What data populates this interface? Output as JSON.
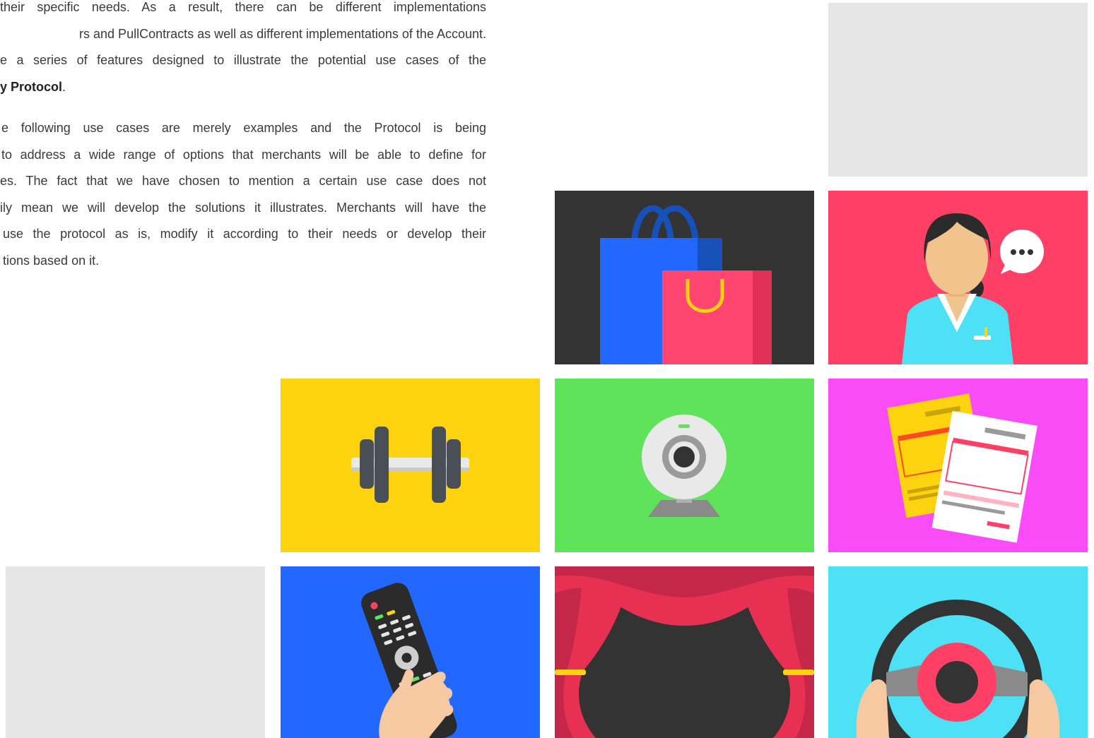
{
  "intro": {
    "paragraph1": [
      "their specific needs. As a result, there can be different implementations",
      "rs and PullContracts as well as different implementations of the Account.",
      "e a series of features designed to illustrate the potential use cases of the"
    ],
    "paragraph1_last_bold": "y Protocol",
    "paragraph1_last_tail": ".",
    "paragraph2": [
      "e following use cases are merely examples and the Protocol is being",
      "to address a wide range of options that merchants will be able to define for",
      "es. The fact that we have chosen to mention a certain use case does not",
      "ily mean we will develop the solutions it illustrates. Merchants will have the",
      "use the protocol as is, modify it according to their needs or develop their",
      "tions based on it."
    ]
  },
  "tiles": [
    {
      "name": "tile-placeholder-top",
      "illustration": "blank",
      "color": "#e6e6e6"
    },
    {
      "name": "tile-shopping",
      "illustration": "shopping-bags-icon",
      "color": "#333333"
    },
    {
      "name": "tile-assistant",
      "illustration": "customer-service-icon",
      "color": "#ff4066"
    },
    {
      "name": "tile-fitness",
      "illustration": "dumbbell-icon",
      "color": "#fdd20e"
    },
    {
      "name": "tile-webcam",
      "illustration": "webcam-icon",
      "color": "#5fe35a"
    },
    {
      "name": "tile-bills",
      "illustration": "utility-bills-icon",
      "color": "#f94cf6"
    },
    {
      "name": "tile-placeholder-bottom",
      "illustration": "blank",
      "color": "#e6e6e6"
    },
    {
      "name": "tile-tv",
      "illustration": "tv-remote-icon",
      "color": "#2368fe"
    },
    {
      "name": "tile-theater",
      "illustration": "theater-curtain-icon",
      "color": "#333333"
    },
    {
      "name": "tile-driving",
      "illustration": "steering-wheel-icon",
      "color": "#4ee1f5"
    }
  ]
}
